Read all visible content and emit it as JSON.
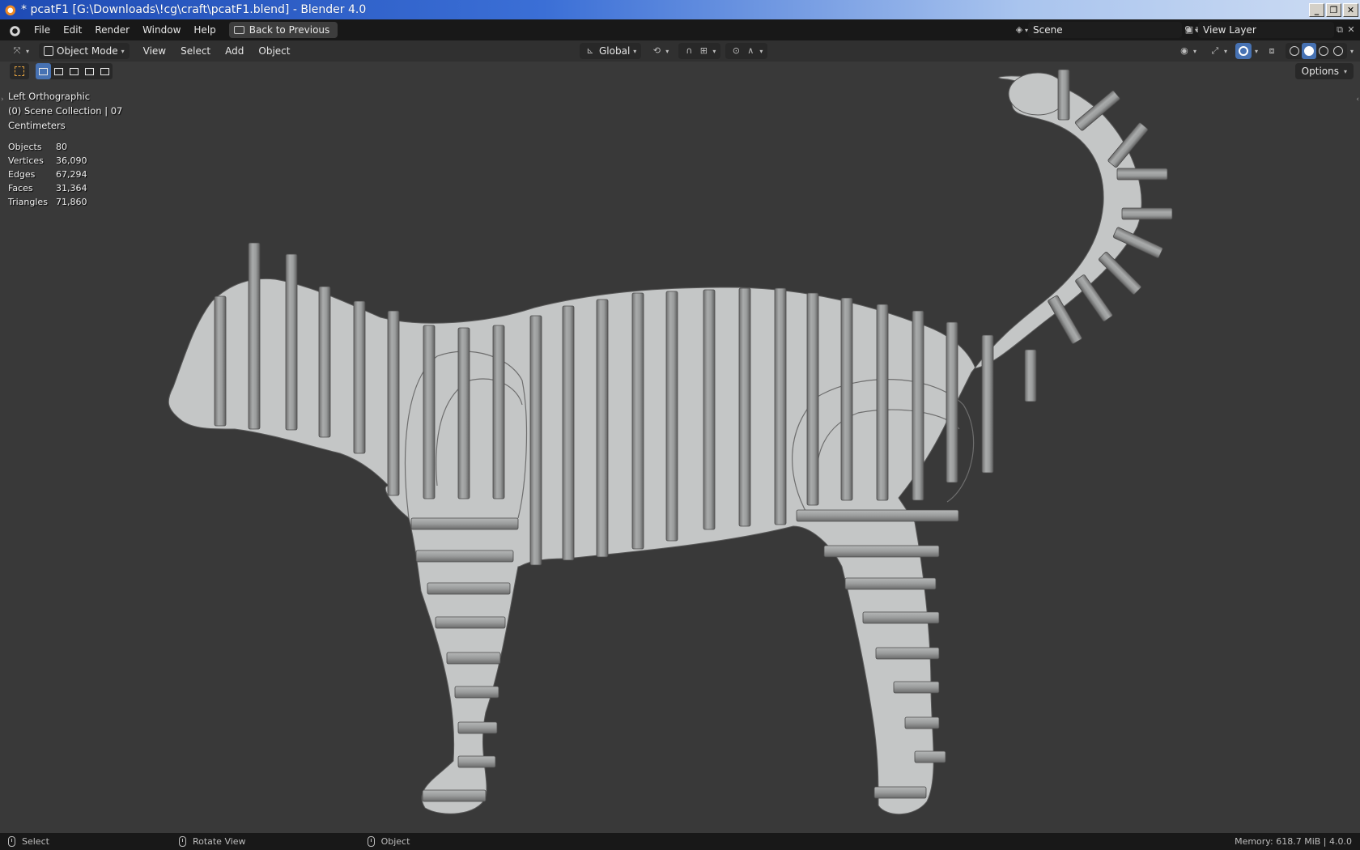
{
  "window": {
    "title": "* pcatF1 [G:\\Downloads\\!cg\\craft\\pcatF1.blend] - Blender 4.0",
    "buttons": [
      "_",
      "❐",
      "✕"
    ]
  },
  "menubar": {
    "items": [
      "File",
      "Edit",
      "Render",
      "Window",
      "Help"
    ],
    "back_button": "Back to Previous",
    "scene_name": "Scene",
    "view_layer_name": "View Layer"
  },
  "viewport_header": {
    "mode": "Object Mode",
    "menus": [
      "View",
      "Select",
      "Add",
      "Object"
    ],
    "transform_orientation": "Global"
  },
  "tool_settings": {
    "options_label": "Options"
  },
  "overlay": {
    "view_name": "Left Orthographic",
    "collection": "(0) Scene Collection | 07",
    "units": "Centimeters",
    "stats": [
      {
        "label": "Objects",
        "value": "80"
      },
      {
        "label": "Vertices",
        "value": "36,090"
      },
      {
        "label": "Edges",
        "value": "67,294"
      },
      {
        "label": "Faces",
        "value": "31,364"
      },
      {
        "label": "Triangles",
        "value": "71,860"
      }
    ]
  },
  "statusbar": {
    "select": "Select",
    "rotate": "Rotate View",
    "object": "Object",
    "memory": "Memory: 618.7 MiB | 4.0.0"
  },
  "colors": {
    "viewport_bg": "#393939",
    "model_fill": "#c4c6c6",
    "slot_fill": "#8a8a8a",
    "accent_blue": "#4772b3"
  }
}
